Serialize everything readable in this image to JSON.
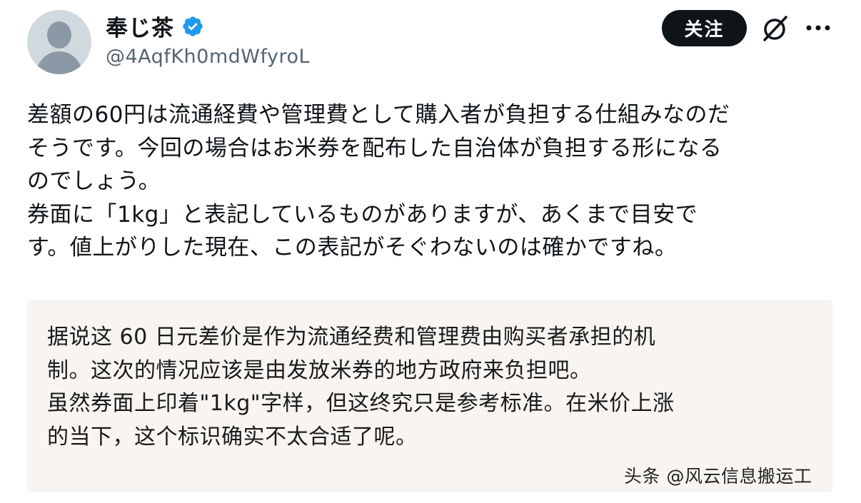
{
  "author": {
    "display_name": "奉じ茶",
    "handle": "@4AqfKh0mdWfyroL",
    "verified_icon": "verified-badge-icon",
    "verified_color": "#1d9bf0"
  },
  "actions": {
    "follow_label": "关注",
    "grok_icon": "grok-icon",
    "more_icon": "more-icon"
  },
  "tweet": {
    "lines": [
      "差額の60円は流通経費や管理費として購入者が負担する仕組みなのだ",
      "そうです。今回の場合はお米券を配布した自治体が負担する形になる",
      "のでしょう。",
      "券面に「1kg」と表記しているものがありますが、あくまで目安で",
      "す。値上がりした現在、この表記がそぐわないのは確かですね。"
    ]
  },
  "translation": {
    "lines": [
      "据说这 60 日元差价是作为流通经费和管理费由购买者承担的机",
      "制。这次的情况应该是由发放米券的地方政府来负担吧。",
      "虽然券面上印着\"1kg\"字样，但这终究只是参考标准。在米价上涨",
      "的当下，这个标识确实不太合适了呢。"
    ]
  },
  "watermark": "头条 @风云信息搬运工"
}
